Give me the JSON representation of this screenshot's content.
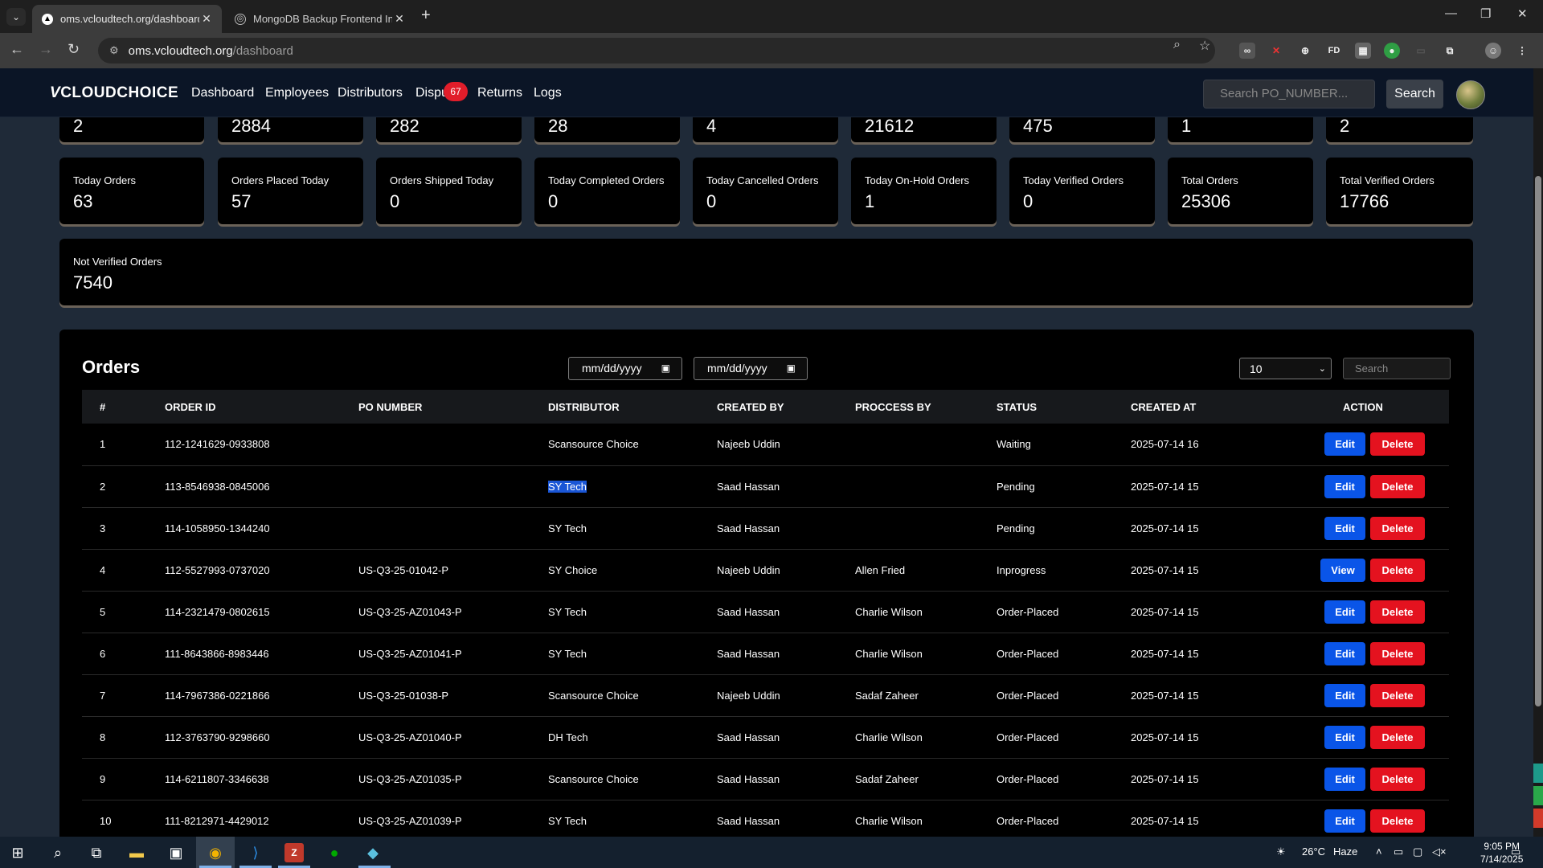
{
  "browser": {
    "tabs": [
      {
        "title": "oms.vcloudtech.org/dashboard",
        "active": true
      },
      {
        "title": "MongoDB Backup Frontend Int",
        "active": false
      }
    ],
    "url_host": "oms.vcloudtech.org",
    "url_path": "/dashboard"
  },
  "app": {
    "logo": "CLOUDCHOICE",
    "nav": [
      "Dashboard",
      "Employees",
      "Distributors",
      "Dispu",
      "Returns",
      "Logs"
    ],
    "disputes_badge": "67",
    "search_placeholder": "Search PO_NUMBER...",
    "search_button": "Search"
  },
  "top_row_values": [
    "2",
    "2884",
    "282",
    "28",
    "4",
    "21612",
    "475",
    "1",
    "2"
  ],
  "stats": [
    {
      "label": "Today Orders",
      "value": "63"
    },
    {
      "label": "Orders Placed Today",
      "value": "57"
    },
    {
      "label": "Orders Shipped Today",
      "value": "0"
    },
    {
      "label": "Today Completed Orders",
      "value": "0"
    },
    {
      "label": "Today Cancelled Orders",
      "value": "0"
    },
    {
      "label": "Today On-Hold Orders",
      "value": "1"
    },
    {
      "label": "Today Verified Orders",
      "value": "0"
    },
    {
      "label": "Total Orders",
      "value": "25306"
    },
    {
      "label": "Total Verified Orders",
      "value": "17766"
    }
  ],
  "not_verified": {
    "label": "Not Verified Orders",
    "value": "7540"
  },
  "orders": {
    "title": "Orders",
    "date_from_placeholder": "mm/dd/yyyy",
    "date_to_placeholder": "mm/dd/yyyy",
    "page_size": "10",
    "search_placeholder": "Search",
    "columns": [
      "#",
      "ORDER ID",
      "PO NUMBER",
      "DISTRIBUTOR",
      "CREATED BY",
      "PROCCESS BY",
      "STATUS",
      "CREATED AT",
      "ACTION"
    ],
    "rows": [
      {
        "n": "1",
        "order_id": "112-1241629-0933808",
        "po": "",
        "dist": "Scansource Choice",
        "created_by": "Najeeb Uddin",
        "process_by": "",
        "status": "Waiting",
        "created_at": "2025-07-14 16",
        "primary": "Edit",
        "delete": "Delete"
      },
      {
        "n": "2",
        "order_id": "113-8546938-0845006",
        "po": "",
        "dist": "SY Tech",
        "created_by": "Saad Hassan",
        "process_by": "",
        "status": "Pending",
        "created_at": "2025-07-14 15",
        "primary": "Edit",
        "delete": "Delete"
      },
      {
        "n": "3",
        "order_id": "114-1058950-1344240",
        "po": "",
        "dist": "SY Tech",
        "created_by": "Saad Hassan",
        "process_by": "",
        "status": "Pending",
        "created_at": "2025-07-14 15",
        "primary": "Edit",
        "delete": "Delete"
      },
      {
        "n": "4",
        "order_id": "112-5527993-0737020",
        "po": "US-Q3-25-01042-P",
        "dist": "SY Choice",
        "created_by": "Najeeb Uddin",
        "process_by": "Allen Fried",
        "status": "Inprogress",
        "created_at": "2025-07-14 15",
        "primary": "View",
        "delete": "Delete"
      },
      {
        "n": "5",
        "order_id": "114-2321479-0802615",
        "po": "US-Q3-25-AZ01043-P",
        "dist": "SY Tech",
        "created_by": "Saad Hassan",
        "process_by": "Charlie Wilson",
        "status": "Order-Placed",
        "created_at": "2025-07-14 15",
        "primary": "Edit",
        "delete": "Delete"
      },
      {
        "n": "6",
        "order_id": "111-8643866-8983446",
        "po": "US-Q3-25-AZ01041-P",
        "dist": "SY Tech",
        "created_by": "Saad Hassan",
        "process_by": "Charlie Wilson",
        "status": "Order-Placed",
        "created_at": "2025-07-14 15",
        "primary": "Edit",
        "delete": "Delete"
      },
      {
        "n": "7",
        "order_id": "114-7967386-0221866",
        "po": "US-Q3-25-01038-P",
        "dist": "Scansource Choice",
        "created_by": "Najeeb Uddin",
        "process_by": "Sadaf Zaheer",
        "status": "Order-Placed",
        "created_at": "2025-07-14 15",
        "primary": "Edit",
        "delete": "Delete"
      },
      {
        "n": "8",
        "order_id": "112-3763790-9298660",
        "po": "US-Q3-25-AZ01040-P",
        "dist": "DH Tech",
        "created_by": "Saad Hassan",
        "process_by": "Charlie Wilson",
        "status": "Order-Placed",
        "created_at": "2025-07-14 15",
        "primary": "Edit",
        "delete": "Delete"
      },
      {
        "n": "9",
        "order_id": "114-6211807-3346638",
        "po": "US-Q3-25-AZ01035-P",
        "dist": "Scansource Choice",
        "created_by": "Saad Hassan",
        "process_by": "Sadaf Zaheer",
        "status": "Order-Placed",
        "created_at": "2025-07-14 15",
        "primary": "Edit",
        "delete": "Delete"
      },
      {
        "n": "10",
        "order_id": "111-8212971-4429012",
        "po": "US-Q3-25-AZ01039-P",
        "dist": "SY Tech",
        "created_by": "Saad Hassan",
        "process_by": "Charlie Wilson",
        "status": "Order-Placed",
        "created_at": "2025-07-14 15",
        "primary": "Edit",
        "delete": "Delete"
      }
    ]
  },
  "taskbar": {
    "weather": "26°C",
    "weather_desc": "Haze",
    "time": "9:05 PM",
    "date": "7/14/2025"
  },
  "colors": {
    "accent": "#0a55e8",
    "danger": "#e4121f",
    "nav_bg": "#0b1526",
    "page_bg": "#1f2a38"
  }
}
